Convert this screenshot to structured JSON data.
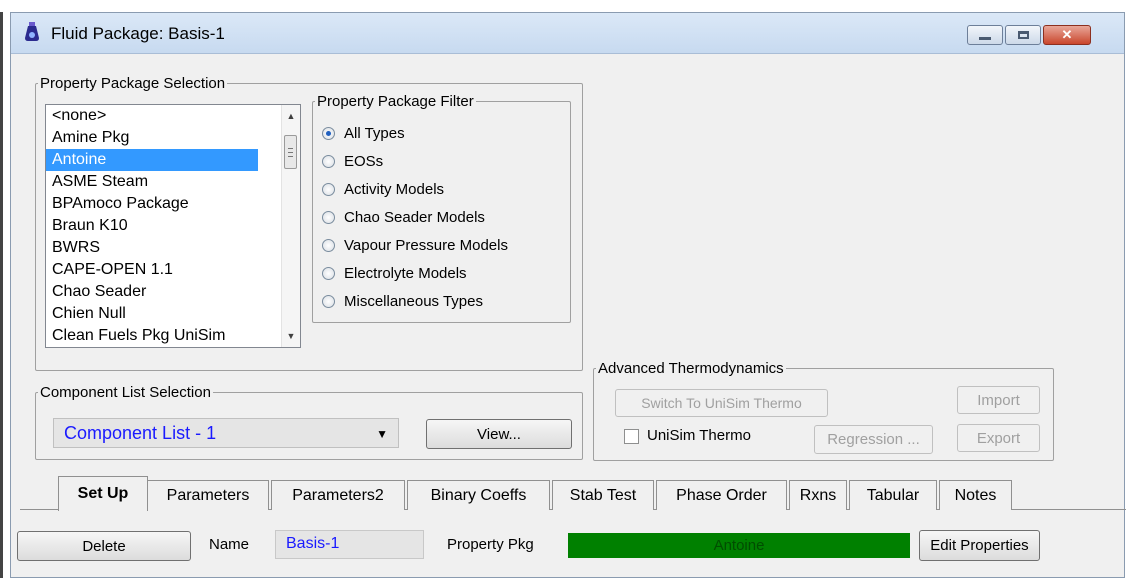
{
  "window": {
    "title": "Fluid Package: Basis-1",
    "controls": [
      "minimize",
      "maximize",
      "close"
    ]
  },
  "property_package_selection": {
    "legend": "Property Package Selection",
    "items": [
      "<none>",
      "Amine Pkg",
      "Antoine",
      "ASME Steam",
      "BPAmoco Package",
      "Braun K10",
      "BWRS",
      "CAPE-OPEN 1.1",
      "Chao Seader",
      "Chien Null",
      "Clean Fuels Pkg UniSim"
    ],
    "selected": "Antoine"
  },
  "property_package_filter": {
    "legend": "Property Package Filter",
    "options": [
      "All Types",
      "EOSs",
      "Activity Models",
      "Chao Seader Models",
      "Vapour Pressure Models",
      "Electrolyte Models",
      "Miscellaneous Types"
    ],
    "selected": "All Types"
  },
  "component_list_selection": {
    "legend": "Component List Selection",
    "value": "Component List - 1",
    "view_button": "View..."
  },
  "advanced_thermodynamics": {
    "legend": "Advanced Thermodynamics",
    "switch_button": "Switch To UniSim Thermo",
    "import_button": "Import",
    "export_button": "Export",
    "unisim_thermo_label": "UniSim Thermo",
    "unisim_thermo_checked": false,
    "regression_button": "Regression ..."
  },
  "tabs": [
    {
      "label": "Set Up",
      "active": true
    },
    {
      "label": "Parameters",
      "active": false
    },
    {
      "label": "Parameters2",
      "active": false
    },
    {
      "label": "Binary Coeffs",
      "active": false
    },
    {
      "label": "Stab Test",
      "active": false
    },
    {
      "label": "Phase Order",
      "active": false
    },
    {
      "label": "Rxns",
      "active": false
    },
    {
      "label": "Tabular",
      "active": false
    },
    {
      "label": "Notes",
      "active": false
    }
  ],
  "footer": {
    "delete_button": "Delete",
    "name_label": "Name",
    "name_value": "Basis-1",
    "property_pkg_label": "Property Pkg",
    "property_pkg_value": "Antoine",
    "edit_properties_button": "Edit Properties"
  },
  "colors": {
    "selection": "#3399ff",
    "pkg_bar": "#008000",
    "value_text": "#1a1aff"
  }
}
